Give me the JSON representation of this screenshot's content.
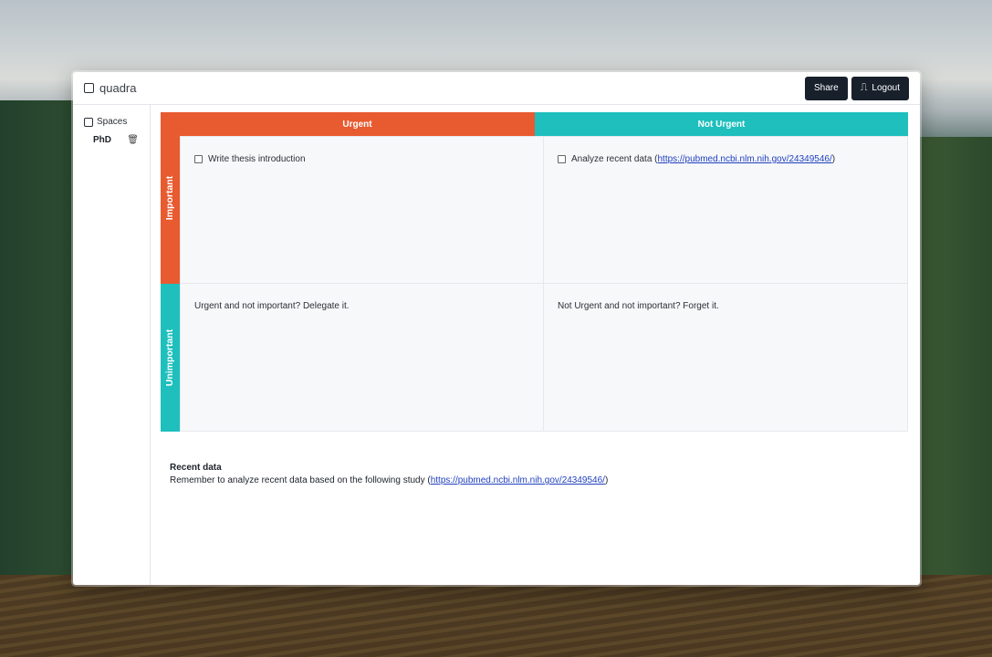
{
  "app": {
    "name": "quadra",
    "share_label": "Share",
    "logout_label": "Logout"
  },
  "sidebar": {
    "spaces_label": "Spaces",
    "items": [
      {
        "label": "PhD"
      }
    ]
  },
  "matrix": {
    "columns": [
      "Urgent",
      "Not Urgent"
    ],
    "rows": [
      "Important",
      "Unimportant"
    ],
    "cells": {
      "urgent_important": {
        "task": "Write thesis introduction",
        "checked": false
      },
      "noturgent_important": {
        "task_prefix": "Analyze recent data (",
        "link": "https://pubmed.ncbi.nlm.nih.gov/24349546/",
        "task_suffix": ")",
        "checked": false
      },
      "urgent_unimportant": {
        "text": "Urgent and not important? Delegate it."
      },
      "noturgent_unimportant": {
        "text": "Not Urgent and not important? Forget it."
      }
    }
  },
  "notes": {
    "title": "Recent data",
    "body_prefix": "Remember to analyze recent data based on the following study (",
    "link": "https://pubmed.ncbi.nlm.nih.gov/24349546/",
    "body_suffix": ")"
  },
  "colors": {
    "urgent": "#e85a30",
    "not_urgent": "#1ebfbd",
    "important": "#e85a30",
    "unimportant": "#1ebfbd",
    "button_dark": "#17202b"
  },
  "icons": [
    "square-logo-icon",
    "square-icon",
    "trash-icon",
    "logout-icon",
    "checkbox-icon"
  ]
}
